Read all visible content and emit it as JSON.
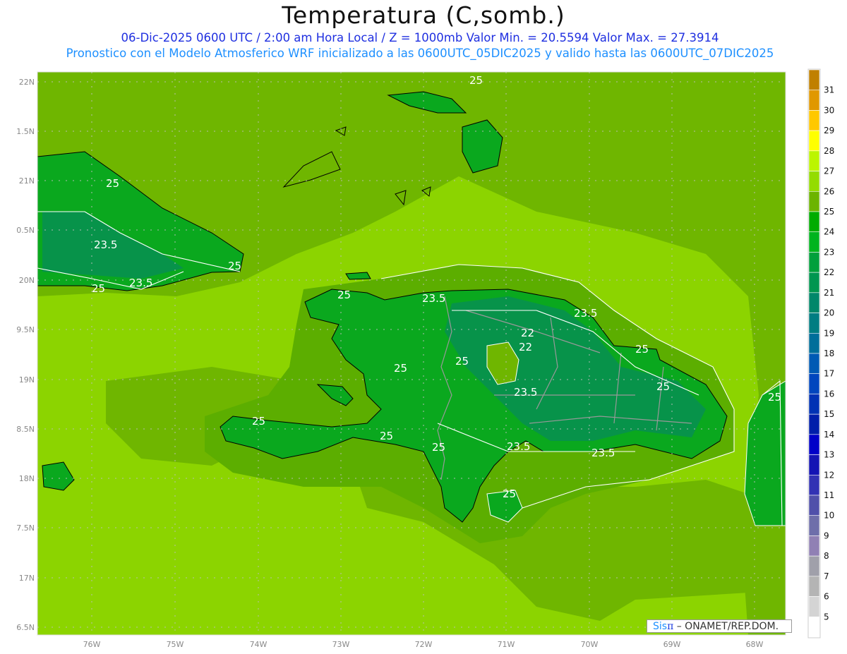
{
  "header": {
    "title": "Temperatura (C,somb.)",
    "line1": "06-Dic-2025  0600 UTC / 2:00 am Hora Local / Z = 1000mb    Valor Min. = 20.5594   Valor Max. = 27.3914",
    "line2": "Pronostico con el Modelo Atmosferico WRF inicializado a las 0600UTC_05DIC2025 y valido hasta las  0600UTC_07DIC2025"
  },
  "map": {
    "lon_labels": [
      "76W",
      "75W",
      "74W",
      "73W",
      "72W",
      "71W",
      "70W",
      "69W",
      "68W"
    ],
    "lat_labels": [
      "22N",
      "1.5N",
      "21N",
      "0.5N",
      "20N",
      "9.5N",
      "19N",
      "8.5N",
      "18N",
      "7.5N",
      "17N",
      "6.5N"
    ],
    "contour_labels": [
      "25",
      "25",
      "23.5",
      "25",
      "25",
      "23.5",
      "25",
      "23.5",
      "23.5",
      "22",
      "22",
      "25",
      "25",
      "23.5",
      "25",
      "25",
      "25",
      "23.5",
      "23.5",
      "25",
      "25",
      "25",
      "25"
    ],
    "colors": {
      "sea_light": "#8cd400",
      "sea_dark": "#6fb600",
      "land": "#0aa81e",
      "land_dark": "#049a38",
      "land_cool": "#07934a"
    }
  },
  "colorbar": {
    "labels": [
      "31",
      "30",
      "29",
      "28",
      "27",
      "26",
      "25",
      "24",
      "23",
      "22",
      "21",
      "20",
      "19",
      "18",
      "17",
      "16",
      "15",
      "14",
      "13",
      "12",
      "11",
      "10",
      "9",
      "8",
      "7",
      "6",
      "5"
    ],
    "colors": [
      "#c08000",
      "#e09800",
      "#ffc800",
      "#ffff00",
      "#bcf500",
      "#94dc00",
      "#6cb400",
      "#00ac00",
      "#00b41e",
      "#00a03c",
      "#009650",
      "#00876a",
      "#007d82",
      "#006e9a",
      "#005ab4",
      "#0046be",
      "#0032b4",
      "#001eaa",
      "#0000c8",
      "#1414b4",
      "#3232b4",
      "#5050aa",
      "#6e6eaa",
      "#9080b4",
      "#a0a0aa",
      "#b4b4b4",
      "#d4d4d4",
      "#ffffff"
    ]
  },
  "logo": {
    "sis": "Sis",
    "pi": "π",
    "rest": "–  ONAMET/REP.DOM."
  }
}
